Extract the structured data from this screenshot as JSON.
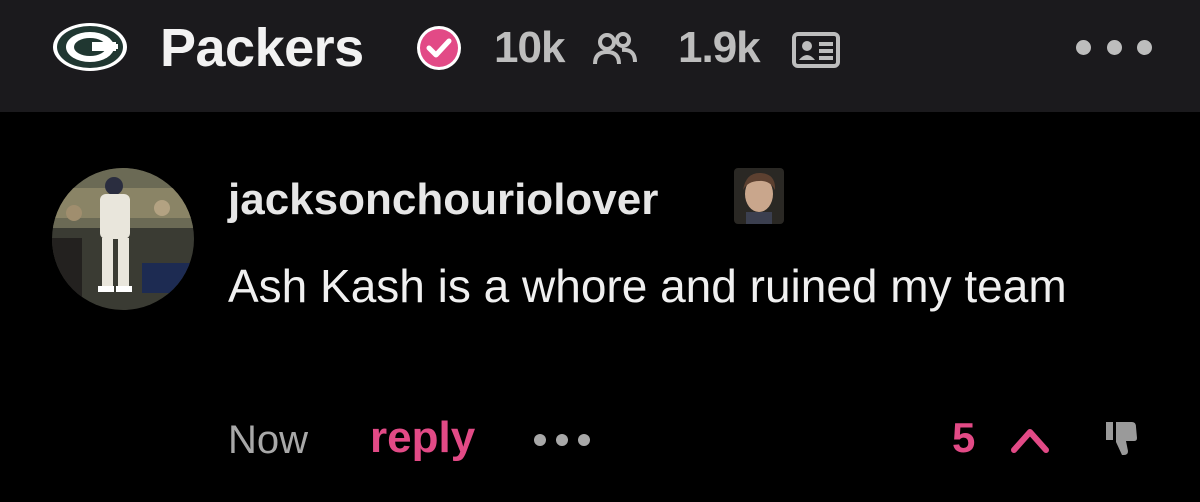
{
  "header": {
    "team_logo_icon": "green-bay-g-logo-icon",
    "team_name": "Packers",
    "verified_icon": "verified-check-icon",
    "members_count": "10k",
    "members_icon": "members-icon",
    "posts_count": "1.9k",
    "posts_icon": "id-card-icon",
    "more_icon": "more-options-icon"
  },
  "comment": {
    "avatar_icon": "user-avatar",
    "username": "jacksonchouriolover",
    "flair_icon": "user-flair-image",
    "text": "Ash Kash is a whore and ruined my team",
    "timestamp": "Now",
    "reply_label": "reply",
    "more_icon": "more-options-icon",
    "vote_count": "5",
    "upvote_icon": "upvote-icon",
    "downvote_icon": "thumbs-down-icon"
  },
  "colors": {
    "header_bg": "#1b1a1d",
    "page_bg": "#000000",
    "accent": "#e24a86",
    "muted": "#a8a8a8",
    "packers_green": "#203731",
    "packers_gold": "#ffb612"
  }
}
